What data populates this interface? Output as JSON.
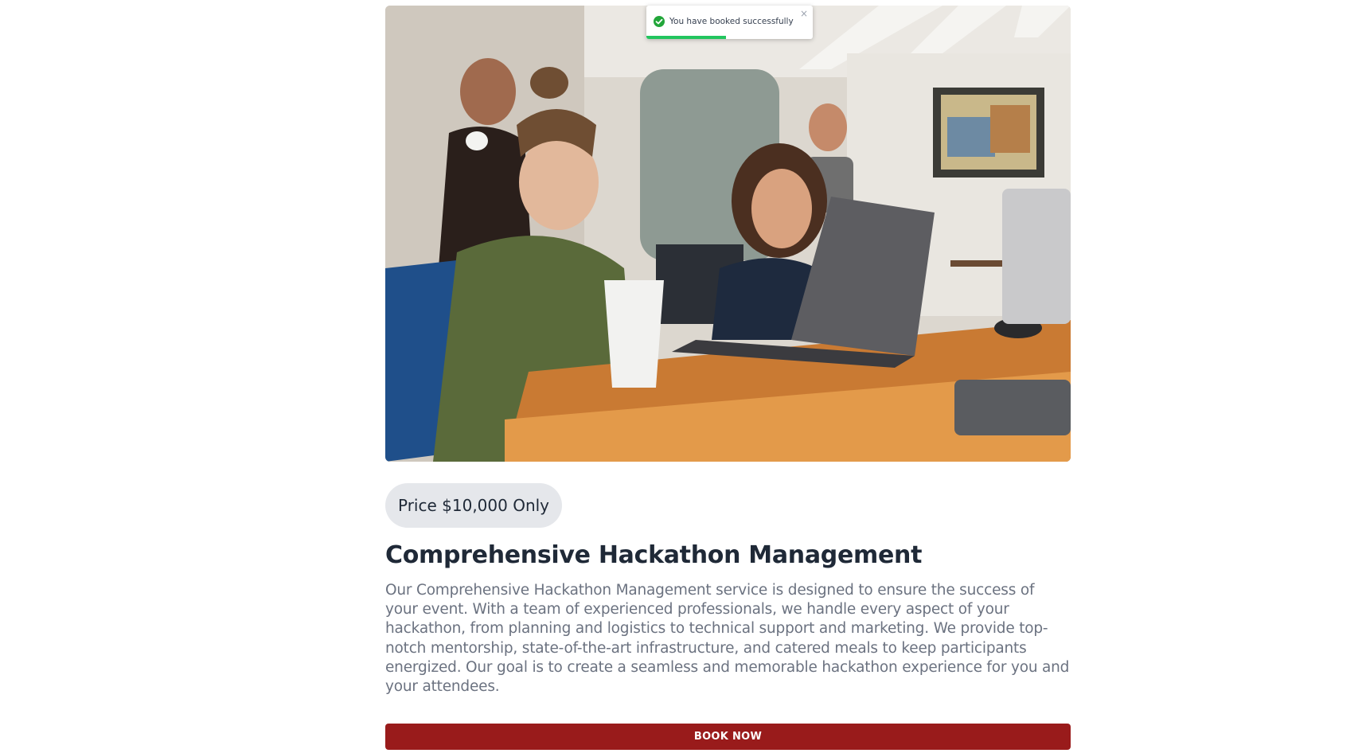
{
  "service": {
    "price_label": "Price $10,000 Only",
    "title": "Comprehensive Hackathon Management",
    "description": "Our Comprehensive Hackathon Management service is designed to ensure the success of your event. With a team of experienced professionals, we handle every aspect of your hackathon, from planning and logistics to technical support and marketing. We provide top-notch mentorship, state-of-the-art infrastructure, and catered meals to keep participants energized. Our goal is to create a seamless and memorable hackathon experience for you and your attendees.",
    "book_button_label": "BOOK NOW",
    "hero_image": "photo of a team working together at a laptop"
  },
  "toast": {
    "message": "You have booked successfully",
    "close_symbol": "×",
    "icon": "check-circle-icon",
    "progress": 0.48
  },
  "colors": {
    "accent": "#991b1b",
    "badge_bg": "#e5e7eb",
    "toast_success": "#22a63a",
    "heading": "#1f2937",
    "body_text": "#6b7280"
  }
}
